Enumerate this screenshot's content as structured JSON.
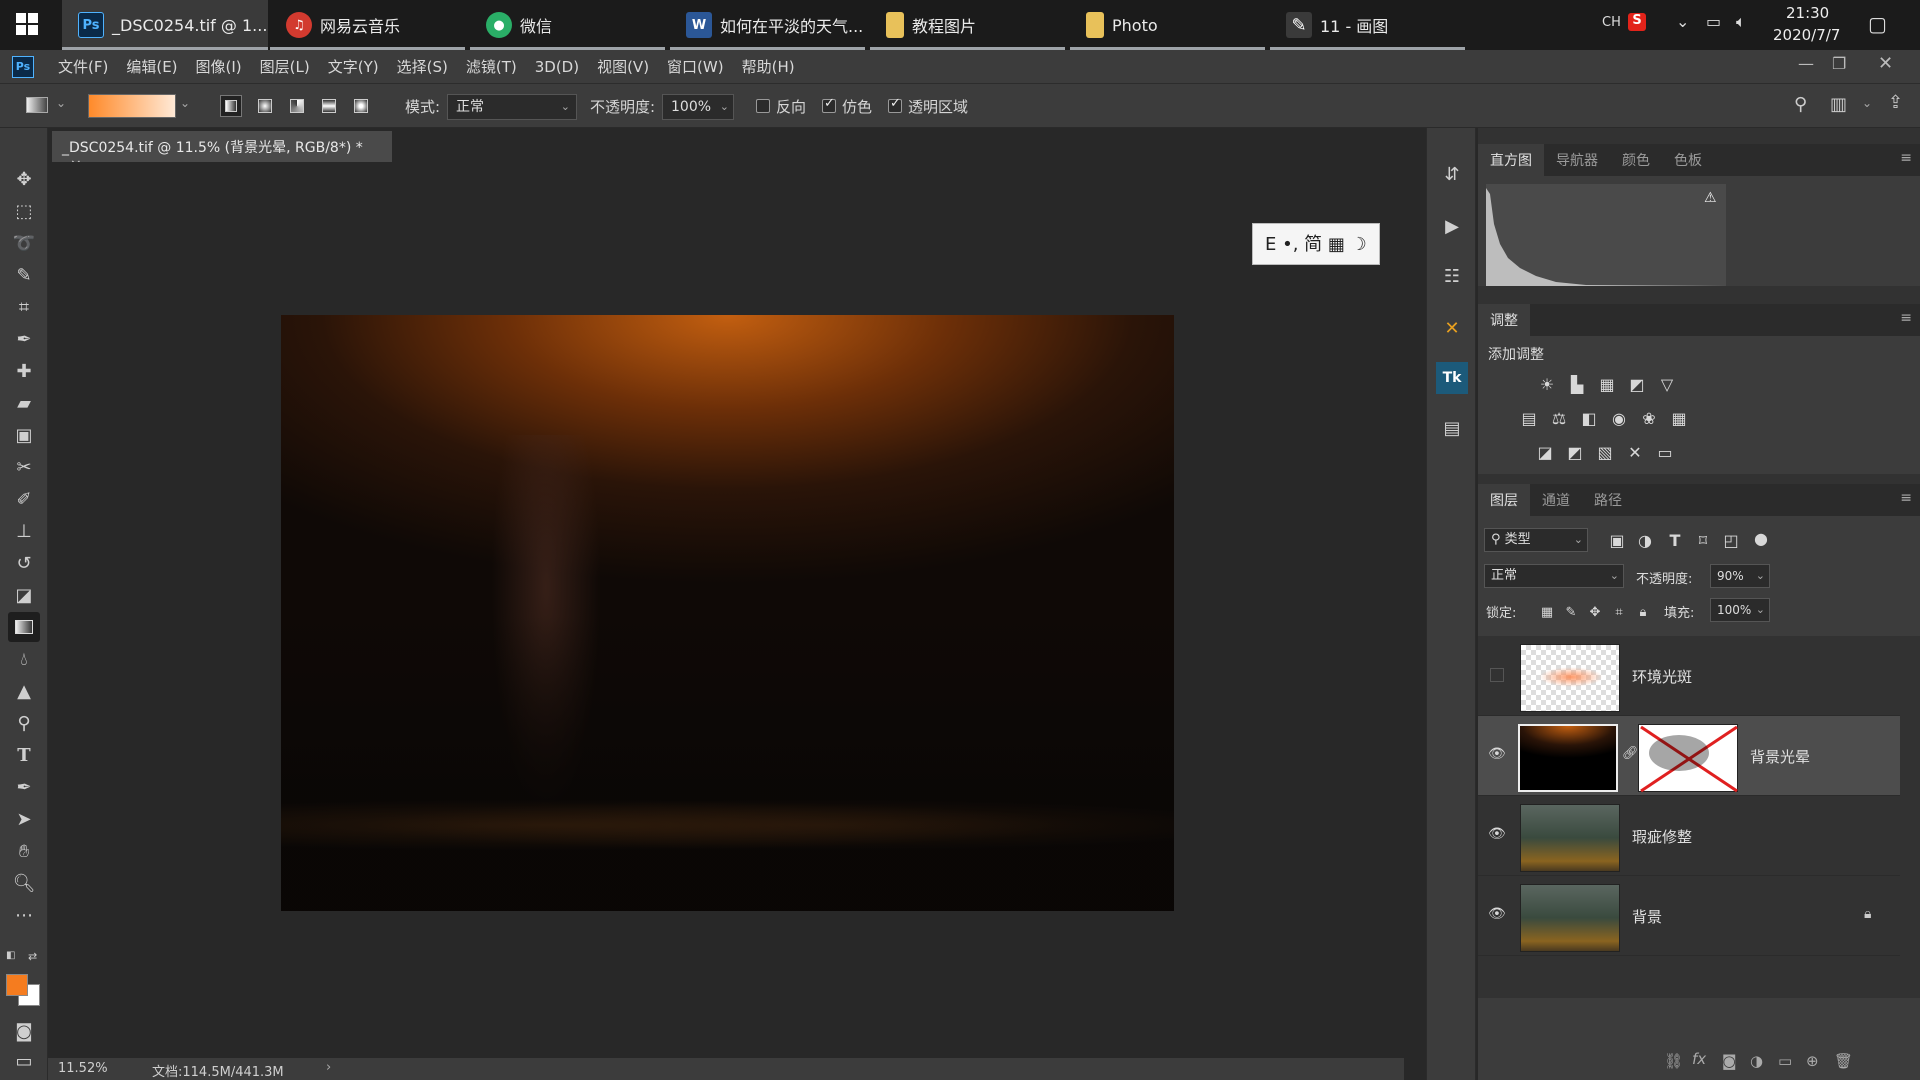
{
  "taskbar": {
    "tasks": [
      {
        "label": "_DSC0254.tif @ 1...",
        "icon": "photoshop-icon",
        "icon_text": "Ps",
        "icon_color": "#0a2a49"
      },
      {
        "label": "网易云音乐",
        "icon": "netease-music-icon",
        "icon_text": "♫",
        "icon_color": "#d23a2f"
      },
      {
        "label": "微信",
        "icon": "wechat-icon",
        "icon_text": "●",
        "icon_color": "#2aae67"
      },
      {
        "label": "如何在平淡的天气...",
        "icon": "word-icon",
        "icon_text": "W",
        "icon_color": "#2b5797"
      },
      {
        "label": "教程图片",
        "icon": "folder-icon",
        "icon_text": "",
        "icon_color": "#e8c15a"
      },
      {
        "label": "Photo",
        "icon": "folder-icon",
        "icon_text": "",
        "icon_color": "#e8c15a"
      },
      {
        "label": "11 - 画图",
        "icon": "paint-icon",
        "icon_text": "🎨",
        "icon_color": "#3a3a3a"
      }
    ],
    "tray": {
      "lang": "CH",
      "ime": "S",
      "time": "21:30",
      "date": "2020/7/7"
    }
  },
  "menubar": {
    "app_icon": "Ps",
    "items": [
      "文件(F)",
      "编辑(E)",
      "图像(I)",
      "图层(L)",
      "文字(Y)",
      "选择(S)",
      "滤镜(T)",
      "3D(D)",
      "视图(V)",
      "窗口(W)",
      "帮助(H)"
    ]
  },
  "options": {
    "mode_label": "模式:",
    "mode_value": "正常",
    "opacity_label": "不透明度:",
    "opacity_value": "100%",
    "reverse_label": "反向",
    "reverse_checked": false,
    "dither_label": "仿色",
    "dither_checked": true,
    "transparency_label": "透明区域",
    "transparency_checked": true,
    "gradient_colors": [
      "#ff8a2a",
      "#ffe9d6"
    ]
  },
  "document": {
    "tab_title": "_DSC0254.tif @ 11.5% (背景光晕, RGB/8*) *",
    "close": "×",
    "ime_badge": "E •, 简 ▦ ☽"
  },
  "status": {
    "zoom": "11.52%",
    "doc_info": "文档:114.5M/441.3M",
    "arrow": "›"
  },
  "panels": {
    "top_tabs": [
      "直方图",
      "导航器",
      "颜色",
      "色板"
    ],
    "adjust_title": "调整",
    "adjust_subtitle": "添加调整",
    "layer_tabs": [
      "图层",
      "通道",
      "路径"
    ],
    "filter_label": "类型",
    "blend_mode": "正常",
    "opacity_label": "不透明度:",
    "opacity_value": "90%",
    "lock_label": "锁定:",
    "fill_label": "填充:",
    "fill_value": "100%",
    "layers": [
      {
        "name": "环境光斑",
        "visible": false
      },
      {
        "name": "背景光晕",
        "visible": true
      },
      {
        "name": "瑕疵修整",
        "visible": true
      },
      {
        "name": "背景",
        "visible": true,
        "locked": true
      }
    ]
  },
  "colors": {
    "foreground": "#f57c1f",
    "background": "#ffffff"
  }
}
